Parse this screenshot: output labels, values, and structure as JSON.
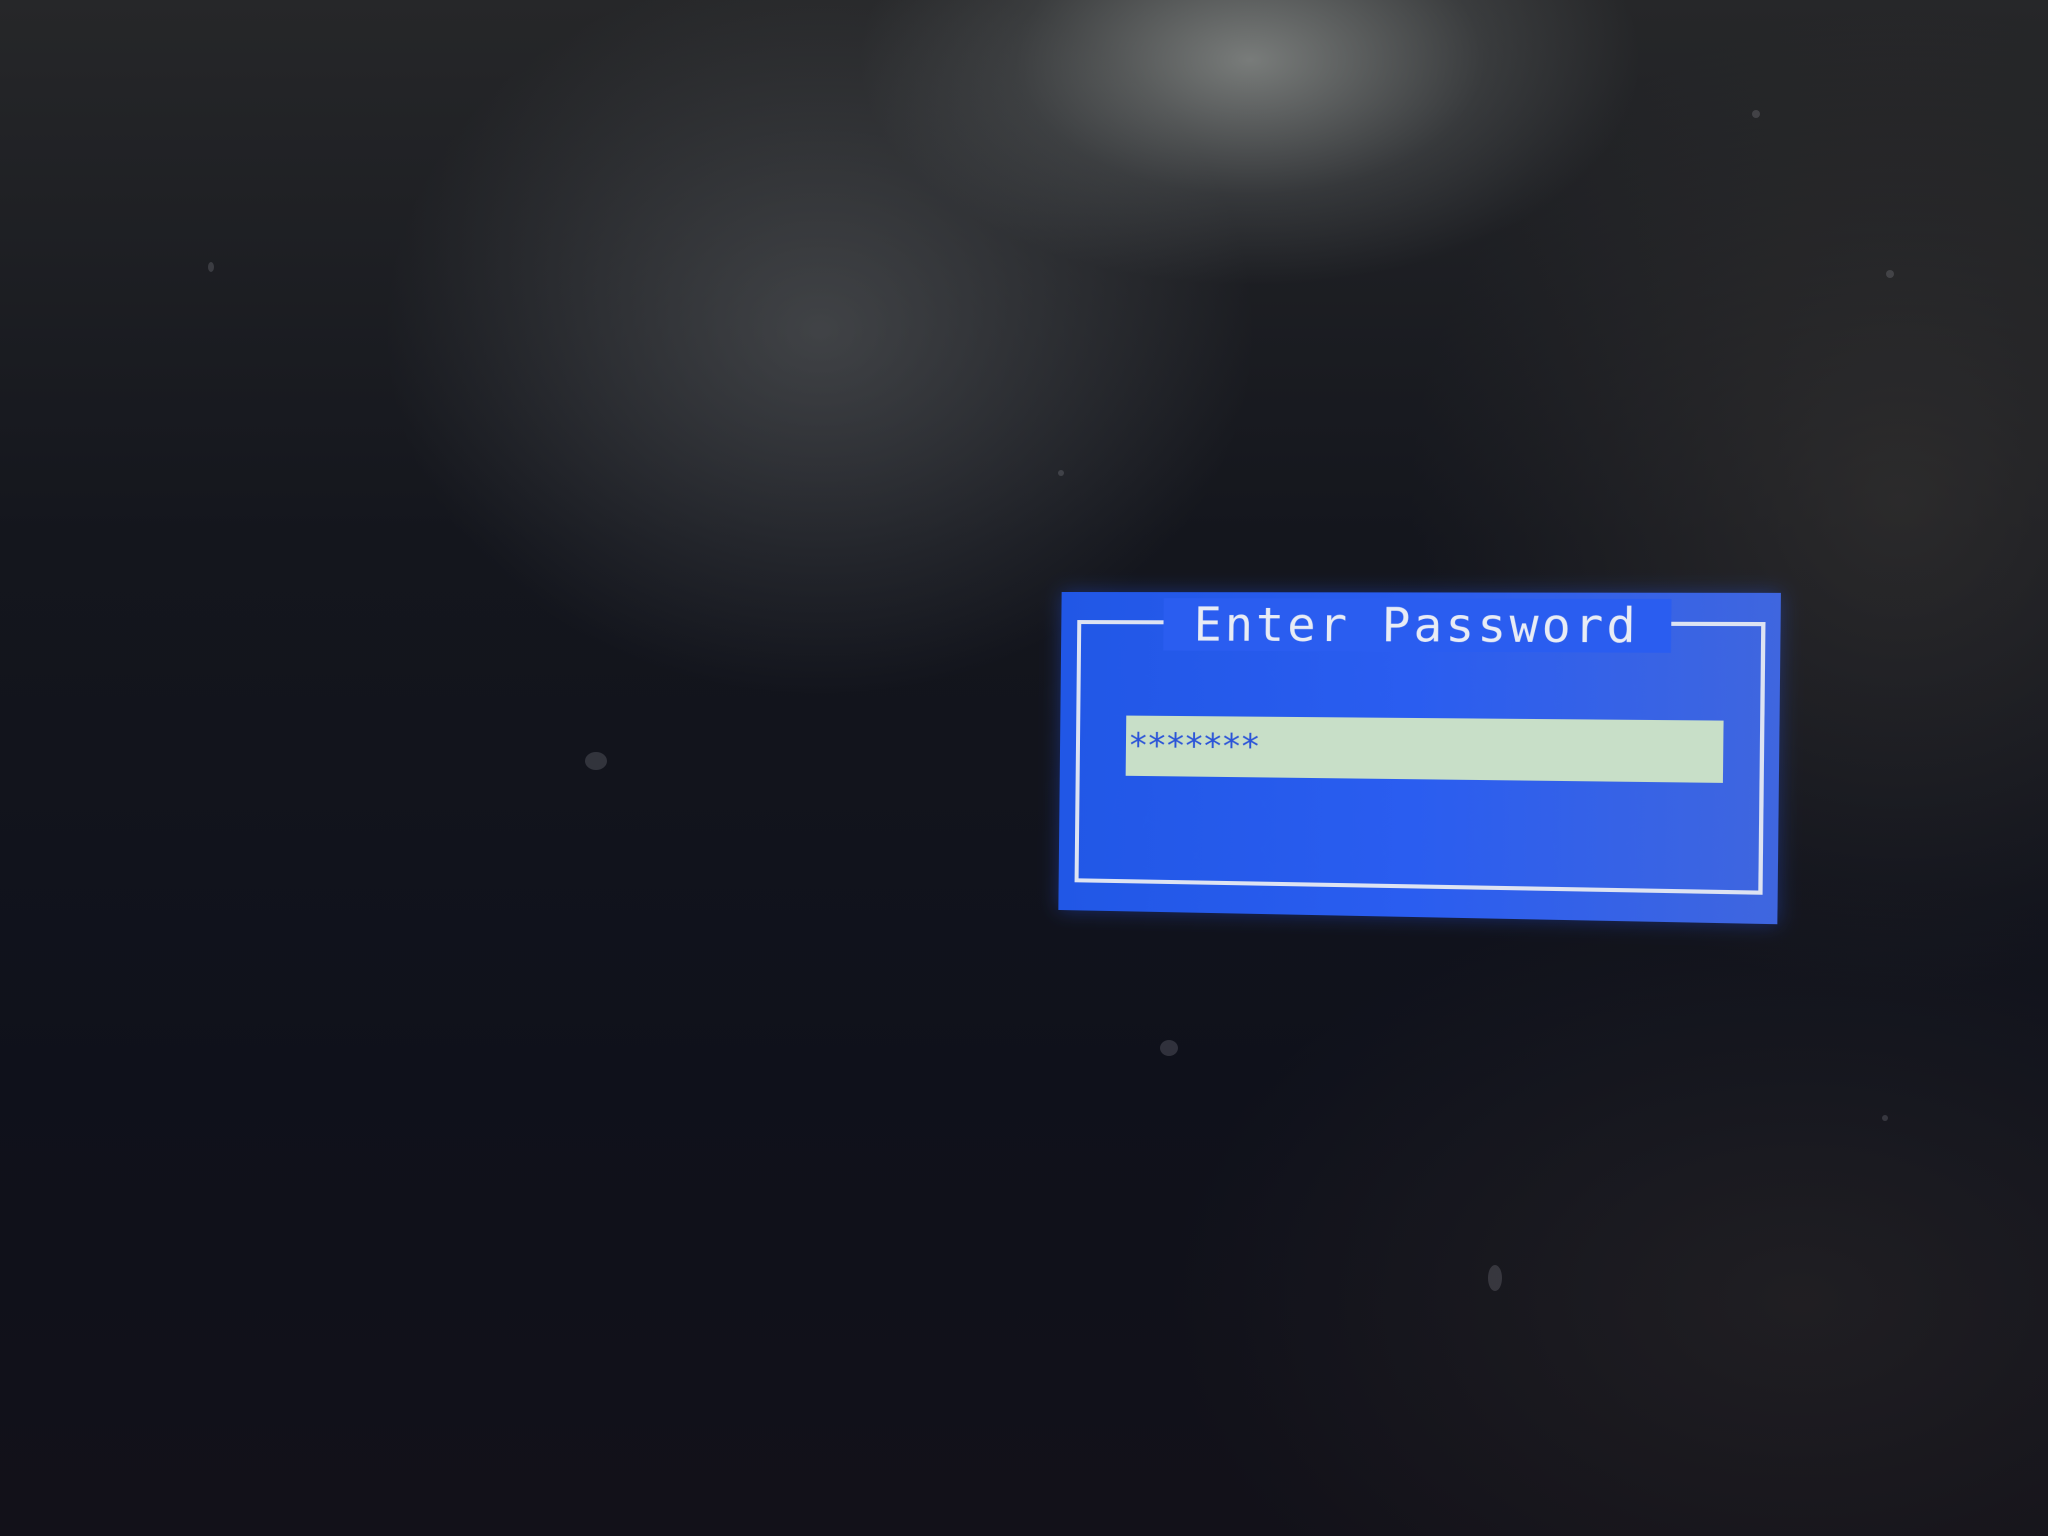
{
  "dialog": {
    "title": "Enter Password",
    "password_value": "*******"
  },
  "colors": {
    "dialog_background": "#2a5df0",
    "frame_line": "#dde3f2",
    "input_background": "#c8dfc8",
    "input_text": "#2b54d8"
  }
}
